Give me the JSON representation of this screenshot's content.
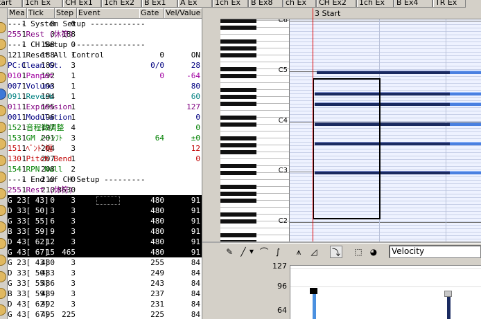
{
  "tabs": [
    "Start",
    "1ch Ex",
    "CH Ex1",
    "1ch Ex2",
    "B Ex1",
    "A Ex",
    "1ch Ex",
    "B Ex8",
    "ch Ex",
    "CH Ex2",
    "1ch Ex",
    "B Ex4",
    "TR Ex"
  ],
  "event_list": {
    "headers": {
      "mea": "Mea",
      "tick": "Tick",
      "step": "Step",
      "event": "Event",
      "gate": "Gate",
      "vel": "Vel/Value"
    },
    "rows": [
      {
        "mea": "1",
        "tick": "0",
        "step": "0",
        "event": "---- System Setup ------------",
        "gate": "",
        "vel": "",
        "color": "#000000"
      },
      {
        "mea": "1",
        "tick": "0",
        "step": "188",
        "event": "255 Rest (休符)",
        "gate": "",
        "vel": "",
        "color": "#800080"
      },
      {
        "mea": "1",
        "tick": "188",
        "step": "0",
        "event": "---- CH Setup ----------------",
        "gate": "",
        "vel": "",
        "color": "#000000"
      },
      {
        "mea": "1",
        "tick": "188",
        "step": "1",
        "event": "121 Reset All Control",
        "gate": "0",
        "vel": "ON",
        "color": "#000000"
      },
      {
        "mea": "1",
        "tick": "189",
        "step": "3",
        "event": "PC:Clean Gt.",
        "gate": "0/0",
        "vel": "28",
        "color": "#000080"
      },
      {
        "mea": "1",
        "tick": "192",
        "step": "1",
        "event": "010 Panpot",
        "gate": "0",
        "vel": "-64",
        "color": "#a000a0"
      },
      {
        "mea": "1",
        "tick": "193",
        "step": "1",
        "event": "007 Volume",
        "gate": "",
        "vel": "80",
        "color": "#000080"
      },
      {
        "mea": "1",
        "tick": "194",
        "step": "1",
        "event": "091 Reverb",
        "gate": "",
        "vel": "60",
        "color": "#008080"
      },
      {
        "mea": "1",
        "tick": "195",
        "step": "1",
        "event": "011 Expression",
        "gate": "",
        "vel": "127",
        "color": "#800080"
      },
      {
        "mea": "1",
        "tick": "196",
        "step": "1",
        "event": "001 Modulation",
        "gate": "",
        "vel": "0",
        "color": "#000080"
      },
      {
        "mea": "1",
        "tick": "197",
        "step": "4",
        "event": "152 音程微調整",
        "gate": "",
        "vel": "0",
        "color": "#008000"
      },
      {
        "mea": "1",
        "tick": "201",
        "step": "3",
        "event": "153 GM ﾉｰﾄｼﾌﾄ",
        "gate": "64",
        "vel": "±0",
        "color": "#008000"
      },
      {
        "mea": "1",
        "tick": "204",
        "step": "3",
        "event": "151 ﾍﾞﾝﾄﾞ幅",
        "gate": "",
        "vel": "12",
        "color": "#c00000"
      },
      {
        "mea": "1",
        "tick": "207",
        "step": "1",
        "event": "130 Pitch Bend",
        "gate": "",
        "vel": "0",
        "color": "#c00000"
      },
      {
        "mea": "1",
        "tick": "208",
        "step": "2",
        "event": "154 RPN Null",
        "gate": "",
        "vel": "",
        "color": "#008000"
      },
      {
        "mea": "1",
        "tick": "210",
        "step": "0",
        "event": "---- End of CH Setup ---------",
        "gate": "",
        "vel": "",
        "color": "#000000"
      },
      {
        "mea": "1",
        "tick": "210",
        "step": "3630",
        "event": "255 Rest (休符)",
        "gate": "",
        "vel": "",
        "color": "#800080"
      },
      {
        "mea": "3",
        "tick": "0",
        "step": "3",
        "event": "G 2 [ 43]",
        "gate": "480",
        "vel": "91",
        "selected": true
      },
      {
        "mea": "3",
        "tick": "3",
        "step": "3",
        "event": "D 3 [ 50]",
        "gate": "480",
        "vel": "91",
        "selected": true
      },
      {
        "mea": "3",
        "tick": "6",
        "step": "3",
        "event": "G 3 [ 55]",
        "gate": "480",
        "vel": "91",
        "selected": true
      },
      {
        "mea": "3",
        "tick": "9",
        "step": "3",
        "event": "B 3 [ 59]",
        "gate": "480",
        "vel": "91",
        "selected": true
      },
      {
        "mea": "3",
        "tick": "12",
        "step": "3",
        "event": "D 4 [ 62]",
        "gate": "480",
        "vel": "91",
        "selected": true
      },
      {
        "mea": "3",
        "tick": "15",
        "step": "465",
        "event": "G 4 [ 67]",
        "gate": "480",
        "vel": "91",
        "selected": true
      },
      {
        "mea": "3",
        "tick": "480",
        "step": "3",
        "event": "G 2 [ 43]",
        "gate": "255",
        "vel": "84",
        "color": "#000000"
      },
      {
        "mea": "3",
        "tick": "483",
        "step": "3",
        "event": "D 3 [ 50]",
        "gate": "249",
        "vel": "84",
        "color": "#000000"
      },
      {
        "mea": "3",
        "tick": "486",
        "step": "3",
        "event": "G 3 [ 55]",
        "gate": "243",
        "vel": "84",
        "color": "#000000"
      },
      {
        "mea": "3",
        "tick": "489",
        "step": "3",
        "event": "B 3 [ 59]",
        "gate": "237",
        "vel": "84",
        "color": "#000000"
      },
      {
        "mea": "3",
        "tick": "492",
        "step": "3",
        "event": "D 4 [ 62]",
        "gate": "231",
        "vel": "84",
        "color": "#000000"
      },
      {
        "mea": "3",
        "tick": "495",
        "step": "225",
        "event": "G 4 [ 67]",
        "gate": "225",
        "vel": "84",
        "color": "#000000"
      }
    ]
  },
  "piano_roll": {
    "ruler_label": "3 Start",
    "octave_labels": [
      "C6",
      "C5",
      "C4",
      "C3",
      "C2"
    ]
  },
  "toolbar": {
    "icons": [
      "pencil-icon",
      "line-icon",
      "dropdown-arrow-icon",
      "curve-icon",
      "curve2-icon",
      "waveform-icon",
      "ramp-icon",
      "snap-icon",
      "select-box-icon",
      "eraser-icon"
    ],
    "control_selector": "Velocity"
  },
  "velocity": {
    "axis_labels": [
      "127",
      "96",
      "64"
    ]
  }
}
